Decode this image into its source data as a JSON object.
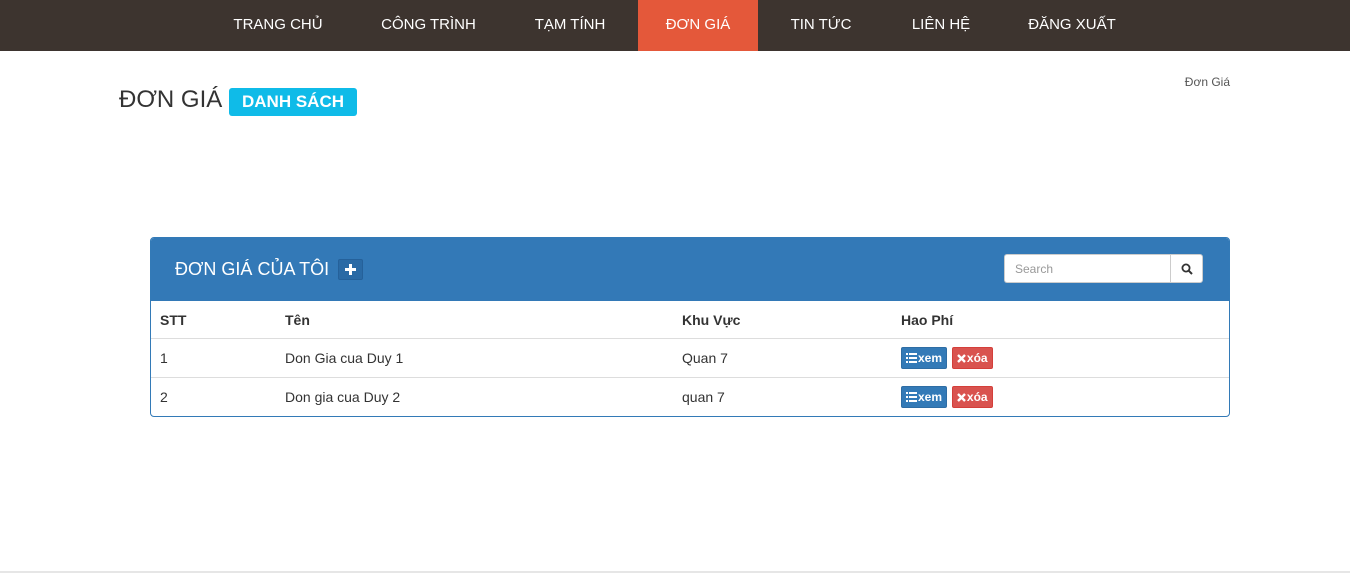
{
  "nav": {
    "items": [
      {
        "label": "TRANG CHỦ"
      },
      {
        "label": "CÔNG TRÌNH"
      },
      {
        "label": "TẠM TÍNH"
      },
      {
        "label": "ĐƠN GIÁ"
      },
      {
        "label": "TIN TỨC"
      },
      {
        "label": "LIÊN HỆ"
      },
      {
        "label": "ĐĂNG XUẤT"
      }
    ],
    "active": "ĐƠN GIÁ",
    "colors": {
      "bar": "#3d342f",
      "active": "#e4583a"
    }
  },
  "header": {
    "title": "ĐƠN GIÁ",
    "badge": "DANH SÁCH",
    "breadcrumb": "Đơn Giá"
  },
  "panel": {
    "title": "ĐƠN GIÁ CỦA TÔI",
    "add_icon": "plus-icon",
    "search_placeholder": "Search",
    "search_icon": "magnifier-icon",
    "color": "#3379b7"
  },
  "table": {
    "columns": [
      "STT",
      "Tên",
      "Khu Vực",
      "Hao Phí"
    ],
    "rows": [
      {
        "stt": "1",
        "ten": "Don Gia cua Duy 1",
        "khu_vuc": "Quan 7"
      },
      {
        "stt": "2",
        "ten": "Don gia cua Duy 2",
        "khu_vuc": "quan 7"
      }
    ],
    "view_label": "xem",
    "delete_label": "xóa",
    "view_icon": "list-icon",
    "delete_icon": "x-icon"
  }
}
